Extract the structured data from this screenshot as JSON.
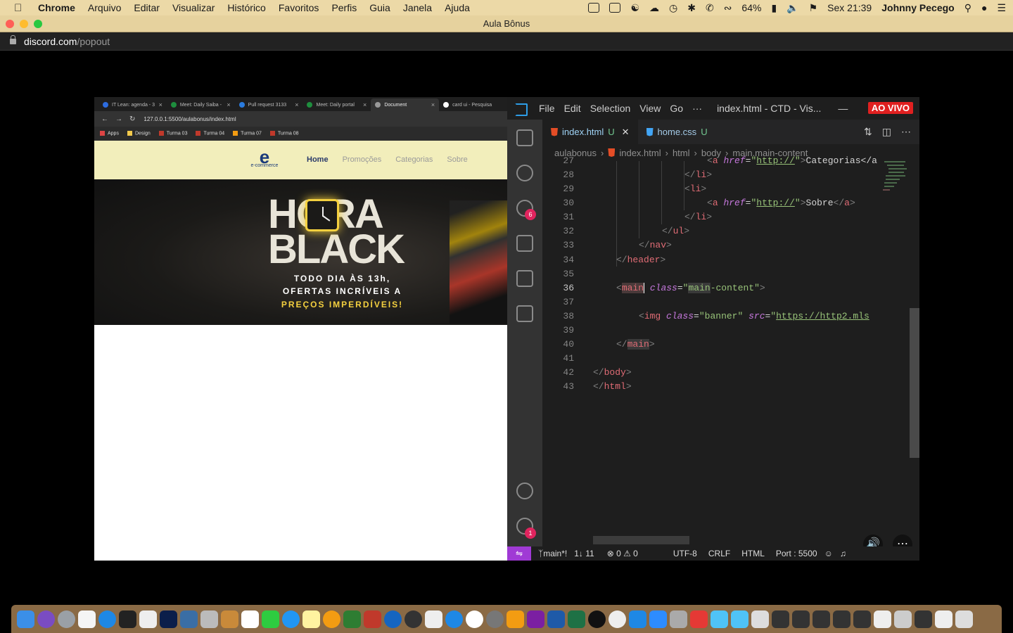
{
  "menubar": {
    "app": "Chrome",
    "items": [
      "Arquivo",
      "Editar",
      "Visualizar",
      "Histórico",
      "Favoritos",
      "Perfis",
      "Guia",
      "Janela",
      "Ajuda"
    ],
    "battery": "64%",
    "datetime": "Sex 21:39",
    "user": "Johnny Pecego"
  },
  "window": {
    "title": "Aula Bônus"
  },
  "address": {
    "host": "discord.com",
    "path": "/popout"
  },
  "browser": {
    "tabs": [
      {
        "label": "IT Lean: agenda - 3",
        "color": "#2d6cdf"
      },
      {
        "label": "Meet: Daily Saiba -",
        "color": "#1e8e3e"
      },
      {
        "label": "Pull request 3133",
        "color": "#2a7bde"
      },
      {
        "label": "Meet: Daily portal",
        "color": "#1e8e3e"
      },
      {
        "label": "Document",
        "color": "#999999"
      },
      {
        "label": "card ui - Pesquisa",
        "color": "#ffffff"
      }
    ],
    "url": "127.0.0.1:5500/aulabonus/index.html",
    "bookmarks": [
      "Apps",
      "Design",
      "Turma 03",
      "Turma 04",
      "Turma 07",
      "Turma 08"
    ],
    "site": {
      "logo_text": "e-commerce",
      "nav": [
        "Home",
        "Promoções",
        "Categorias",
        "Sobre"
      ],
      "banner_title": "HORA BLACK",
      "banner_line1": "TODO DIA ÀS 13h,",
      "banner_line2": "OFERTAS INCRÍVEIS A",
      "banner_line3": "PREÇOS IMPERDÍVEIS!"
    }
  },
  "vscode": {
    "menu": [
      "File",
      "Edit",
      "Selection",
      "View",
      "Go",
      "···"
    ],
    "title": "index.html - CTD - Vis...",
    "live_badge": "AO VIVO",
    "tabs": [
      {
        "name": "index.html",
        "status": "U",
        "active": true
      },
      {
        "name": "home.css",
        "status": "U",
        "active": false
      }
    ],
    "breadcrumbs": [
      "aulabonus",
      "index.html",
      "html",
      "body",
      "main.main-content"
    ],
    "scm_badge": "6",
    "settings_badge": "1",
    "line_numbers": [
      "27",
      "28",
      "29",
      "30",
      "31",
      "32",
      "33",
      "34",
      "35",
      "36",
      "37",
      "38",
      "39",
      "40",
      "41",
      "42",
      "43"
    ],
    "status": {
      "branch": "main*!",
      "sync": "1↓ 11",
      "problems": "⊗ 0 ⚠ 0",
      "encoding": "UTF-8",
      "eol": "CRLF",
      "language": "HTML",
      "port": "Port : 5500"
    }
  },
  "colors": {
    "menubar": "#ecd9a7",
    "vscode_bg": "#1e1e1e",
    "live_red": "#e02020",
    "banner_yellow": "#f4d03f"
  }
}
